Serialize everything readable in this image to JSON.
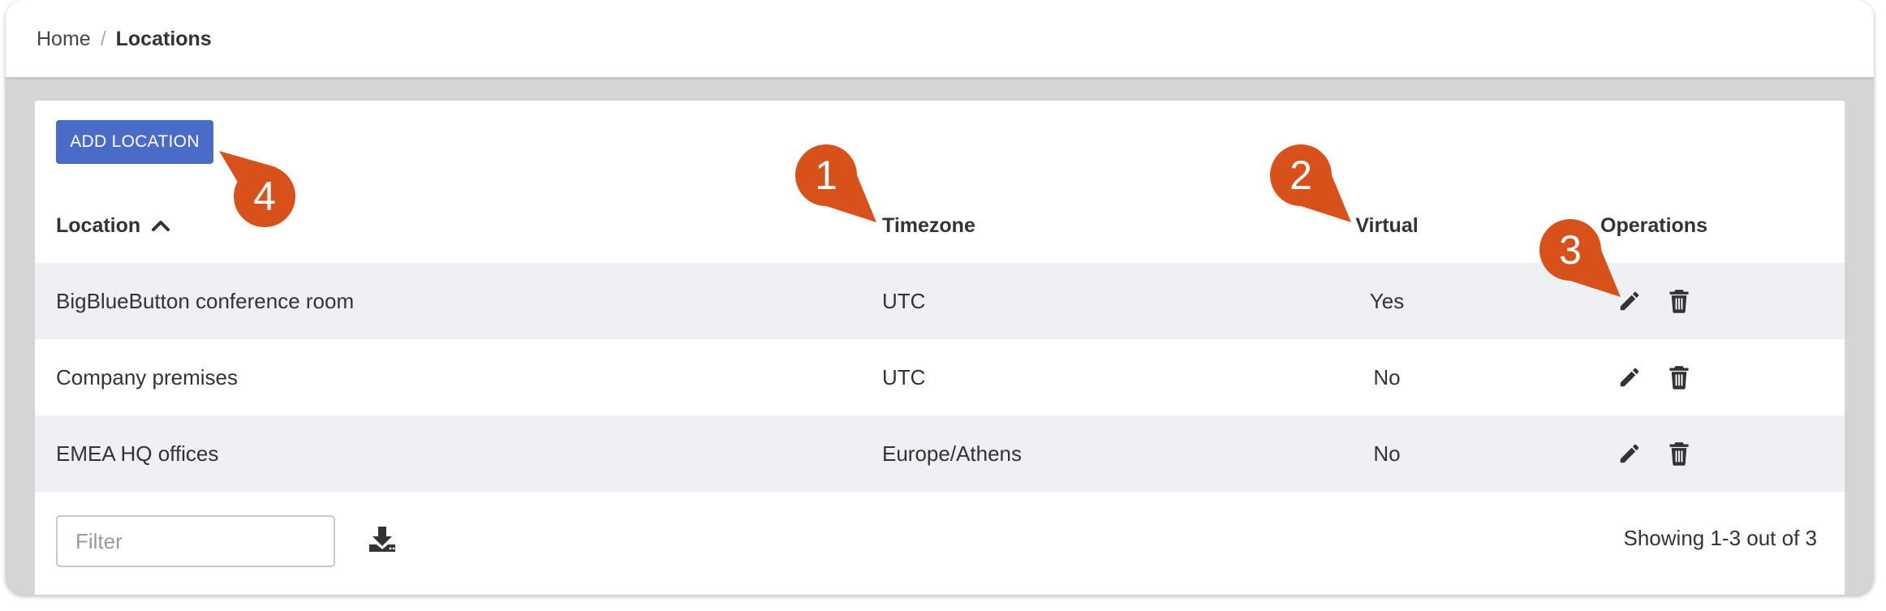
{
  "breadcrumb": {
    "home": "Home",
    "separator": "/",
    "current": "Locations"
  },
  "toolbar": {
    "add_label": "ADD LOCATION"
  },
  "table": {
    "headers": {
      "location": "Location",
      "timezone": "Timezone",
      "virtual": "Virtual",
      "operations": "Operations"
    },
    "sort": {
      "column": "Location",
      "direction": "ascending"
    },
    "rows": [
      {
        "name": "BigBlueButton conference room",
        "timezone": "UTC",
        "virtual": "Yes"
      },
      {
        "name": "Company premises",
        "timezone": "UTC",
        "virtual": "No"
      },
      {
        "name": "EMEA HQ offices",
        "timezone": "Europe/Athens",
        "virtual": "No"
      }
    ]
  },
  "footer": {
    "filter_placeholder": "Filter",
    "showing": "Showing 1-3 out of 3"
  },
  "callouts": [
    "1",
    "2",
    "3",
    "4"
  ],
  "colors": {
    "accent": "#4a6cc8",
    "callout": "#d8501a",
    "stripe": "#eef0f4"
  },
  "icons": {
    "edit": "pencil-icon",
    "delete": "trash-icon",
    "download": "download-icon",
    "sort": "chevron-up-icon"
  }
}
